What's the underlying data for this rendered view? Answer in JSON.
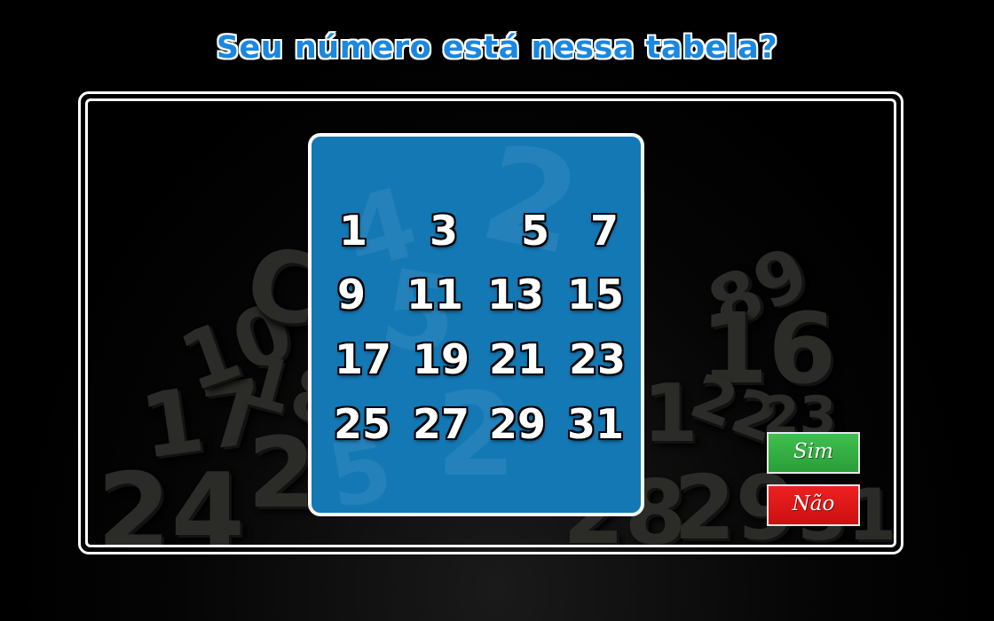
{
  "title": "Seu número está nessa tabela?",
  "numbers": [
    "1",
    "3",
    "5",
    "7",
    "9",
    "11",
    "13",
    "15",
    "17",
    "19",
    "21",
    "23",
    "25",
    "27",
    "29",
    "31"
  ],
  "buttons": {
    "yes_label": "Sim",
    "no_label": "Não"
  },
  "colors": {
    "title": "#1a87e0",
    "card": "#1478b4",
    "yes_button": "#3fc04f",
    "no_button": "#ee2020"
  }
}
